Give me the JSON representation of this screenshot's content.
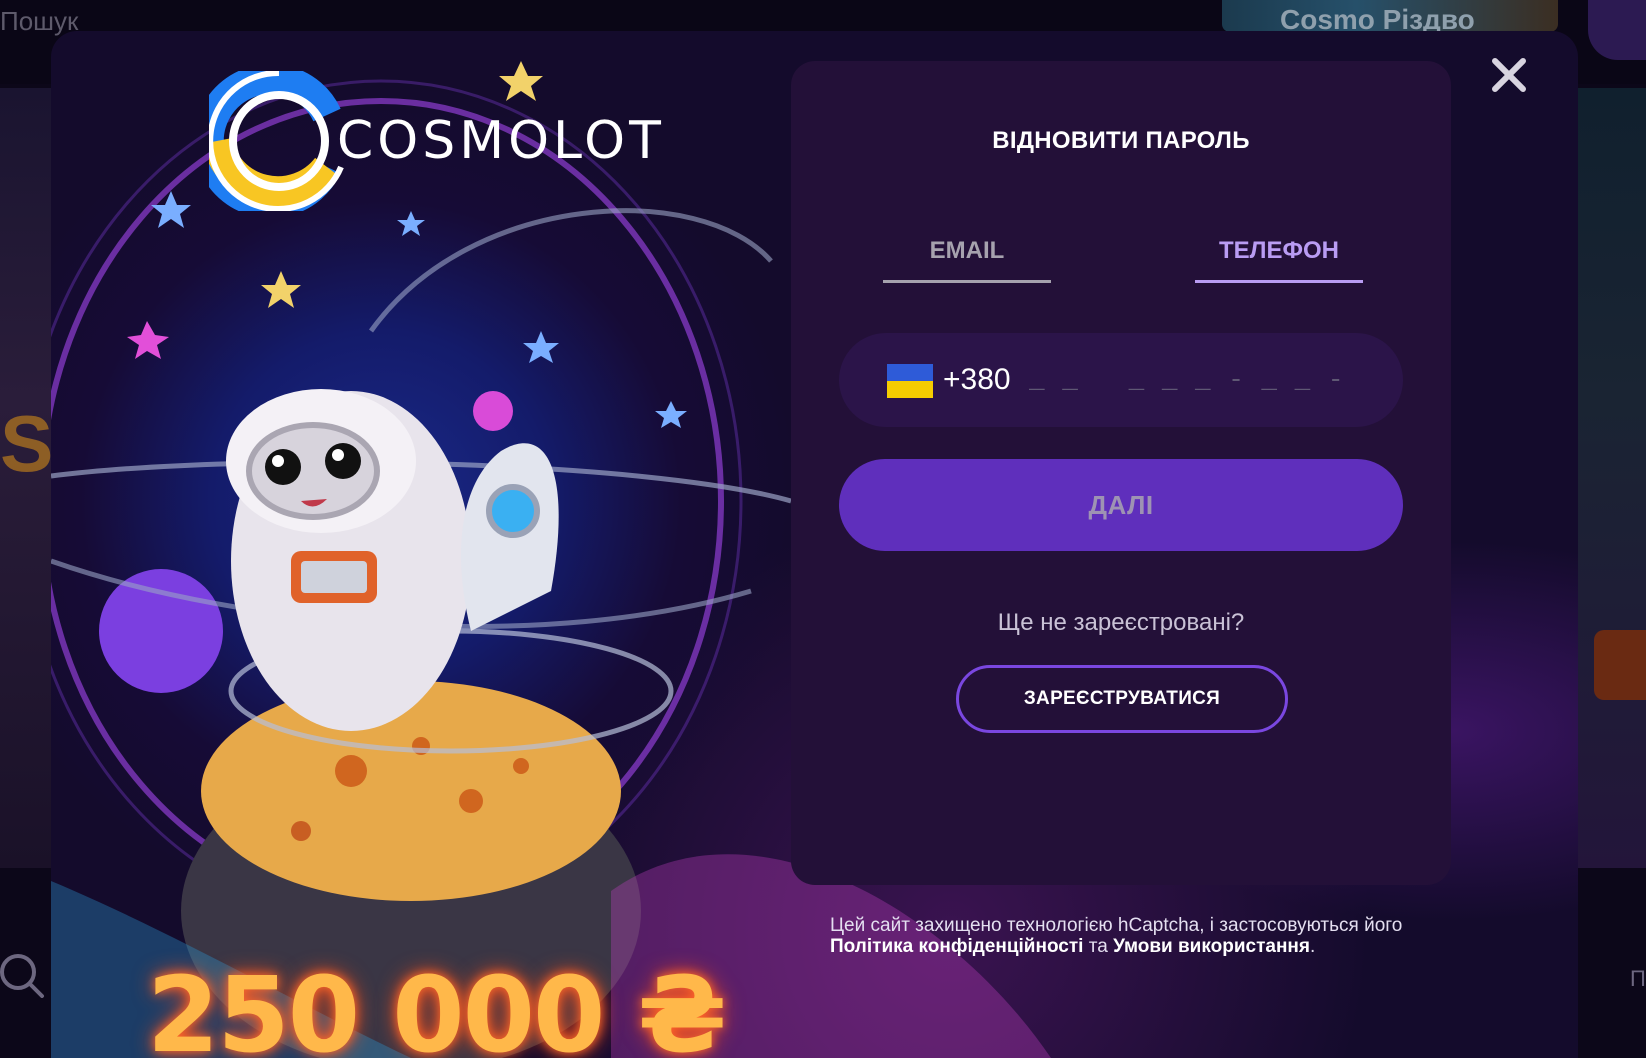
{
  "background": {
    "search_label": "Пошук",
    "promo_label": "Cosmo Різдво",
    "side_letter": "S",
    "bottom_right_text": "П"
  },
  "modal": {
    "logo_text": "COSMOLOT",
    "prize_text": "250 000 ₴",
    "close_icon": "close-icon",
    "form": {
      "title": "ВІДНОВИТИ ПАРОЛЬ",
      "tabs": [
        {
          "label": "EMAIL",
          "active": false
        },
        {
          "label": "ТЕЛЕФОН",
          "active": true
        }
      ],
      "phone": {
        "flag": "ukraine-flag-icon",
        "dial_code": "+380",
        "placeholder": "_ _   _ _ _ - _ _ - _ _",
        "value": ""
      },
      "next_label": "ДАЛІ",
      "not_registered_text": "Ще не зареєстровані?",
      "register_label": "ЗАРЕЄСТРУВАТИСЯ"
    },
    "captcha": {
      "prefix": "Цей сайт захищено технологією hCaptcha, і застосовуються його",
      "privacy_label": "Політика конфіденційності",
      "and_text": "та",
      "terms_label": "Умови використання",
      "suffix": "."
    }
  },
  "colors": {
    "panel_bg": "#231038",
    "accent": "#b99cf3",
    "button_bg": "#5f2fbc",
    "register_border": "#7a47e0",
    "logo_blue": "#1e7df2",
    "logo_yellow": "#f8c623"
  }
}
